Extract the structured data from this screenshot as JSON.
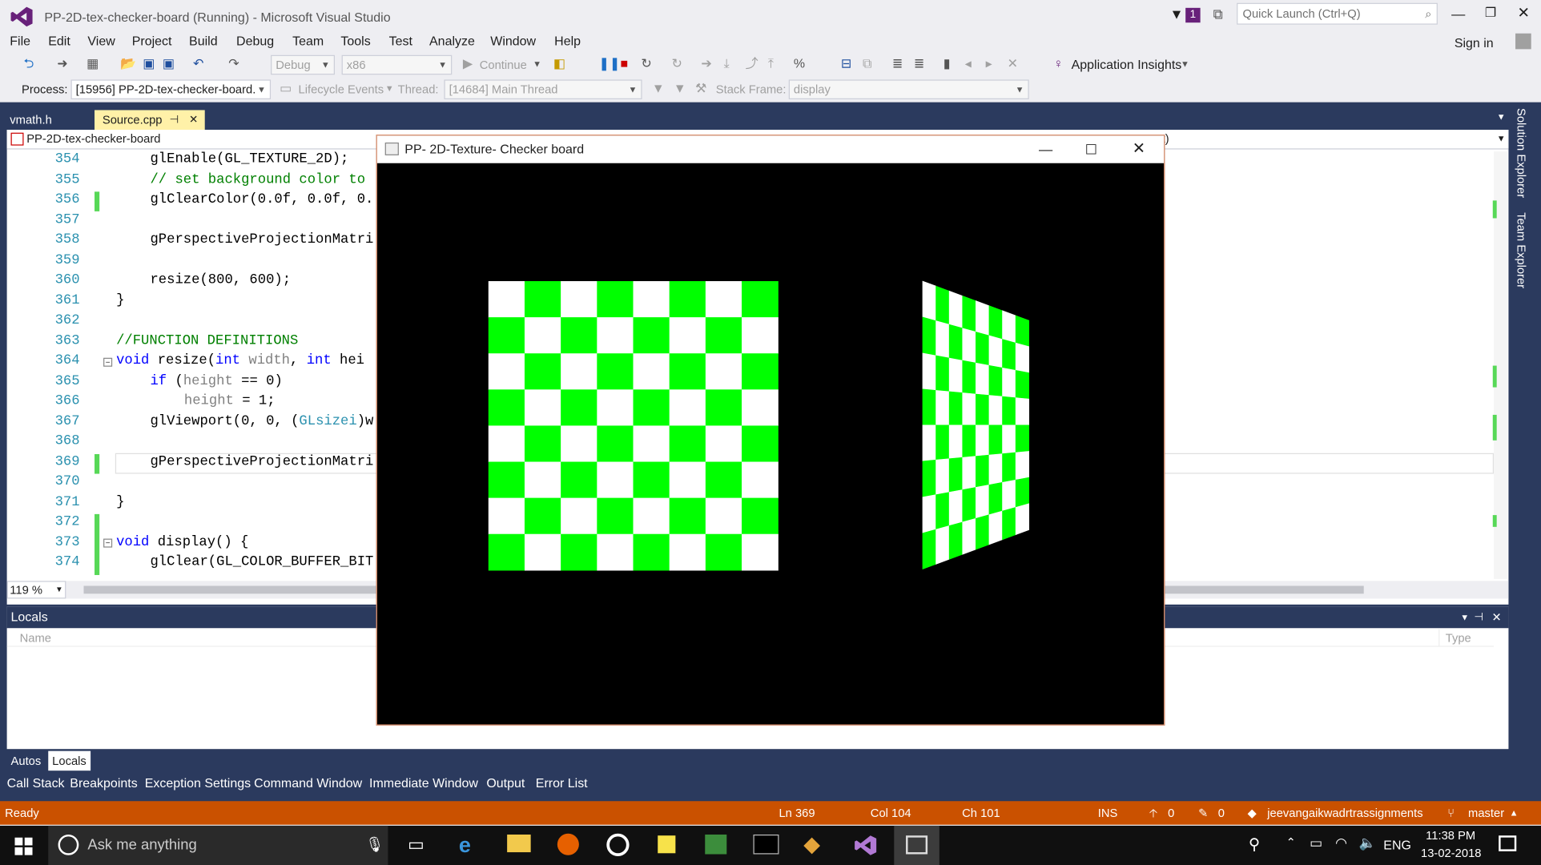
{
  "window": {
    "title": "PP-2D-tex-checker-board (Running) - Microsoft Visual Studio",
    "notif_count": "1",
    "quick_launch_placeholder": "Quick Launch (Ctrl+Q)",
    "sign_in": "Sign in"
  },
  "menu": [
    "File",
    "Edit",
    "View",
    "Project",
    "Build",
    "Debug",
    "Team",
    "Tools",
    "Test",
    "Analyze",
    "Window",
    "Help"
  ],
  "toolbar": {
    "config": "Debug",
    "platform": "x86",
    "continue": "Continue",
    "app_insights": "Application Insights"
  },
  "debugbar": {
    "process_label": "Process:",
    "process_value": "[15956] PP-2D-tex-checker-board.",
    "lifecycle": "Lifecycle Events",
    "thread_label": "Thread:",
    "thread_value": "[14684] Main Thread",
    "stack_label": "Stack Frame:",
    "stack_value": "display"
  },
  "tabs": [
    {
      "label": "vmath.h"
    },
    {
      "label": "Source.cpp",
      "pin": "⊣",
      "close": "✕"
    }
  ],
  "editor": {
    "project": "PP-2D-tex-checker-board",
    "nav_right": "t)",
    "zoom": "119 %",
    "lines": [
      {
        "n": "354",
        "t": "glEnable(GL_TEXTURE_2D);"
      },
      {
        "n": "355",
        "t": "// set background color to"
      },
      {
        "n": "356",
        "t": "glClearColor(0.0f, 0.0f, 0."
      },
      {
        "n": "357",
        "t": ""
      },
      {
        "n": "358",
        "t": "gPerspectiveProjectionMatri"
      },
      {
        "n": "359",
        "t": ""
      },
      {
        "n": "360",
        "t": "resize(800, 600);"
      },
      {
        "n": "361",
        "t": "}"
      },
      {
        "n": "362",
        "t": ""
      },
      {
        "n": "363",
        "t": "//FUNCTION DEFINITIONS"
      },
      {
        "n": "364",
        "t": "void resize(int width, int hei"
      },
      {
        "n": "365",
        "t": "if (height == 0)"
      },
      {
        "n": "366",
        "t": "height = 1;"
      },
      {
        "n": "367",
        "t": "glViewport(0, 0, (GLsizei)w"
      },
      {
        "n": "368",
        "t": ""
      },
      {
        "n": "369",
        "t": "gPerspectiveProjectionMatri"
      },
      {
        "n": "370",
        "t": ""
      },
      {
        "n": "371",
        "t": "}"
      },
      {
        "n": "372",
        "t": ""
      },
      {
        "n": "373",
        "t": "void display() {"
      },
      {
        "n": "374",
        "t": "glClear(GL_COLOR_BUFFER_BIT"
      }
    ]
  },
  "locals": {
    "title": "Locals",
    "col_name": "Name",
    "col_type": "Type"
  },
  "bottom_tabs": [
    "Autos",
    "Locals"
  ],
  "tool_windows": [
    "Call Stack",
    "Breakpoints",
    "Exception Settings",
    "Command Window",
    "Immediate Window",
    "Output",
    "Error List"
  ],
  "status": {
    "ready": "Ready",
    "ln": "Ln 369",
    "col": "Col 104",
    "ch": "Ch 101",
    "ins": "INS",
    "up": "0",
    "edits": "0",
    "repo": "jeevangaikwadrtrassignments",
    "branch": "master"
  },
  "side_tabs": [
    "Solution Explorer",
    "Team Explorer"
  ],
  "app": {
    "title": "PP- 2D-Texture- Checker board",
    "colors": {
      "green": "#00ff00",
      "white": "#ffffff"
    }
  },
  "taskbar": {
    "search_placeholder": "Ask me anything",
    "lang": "ENG",
    "time": "11:38 PM",
    "date": "13-02-2018"
  }
}
